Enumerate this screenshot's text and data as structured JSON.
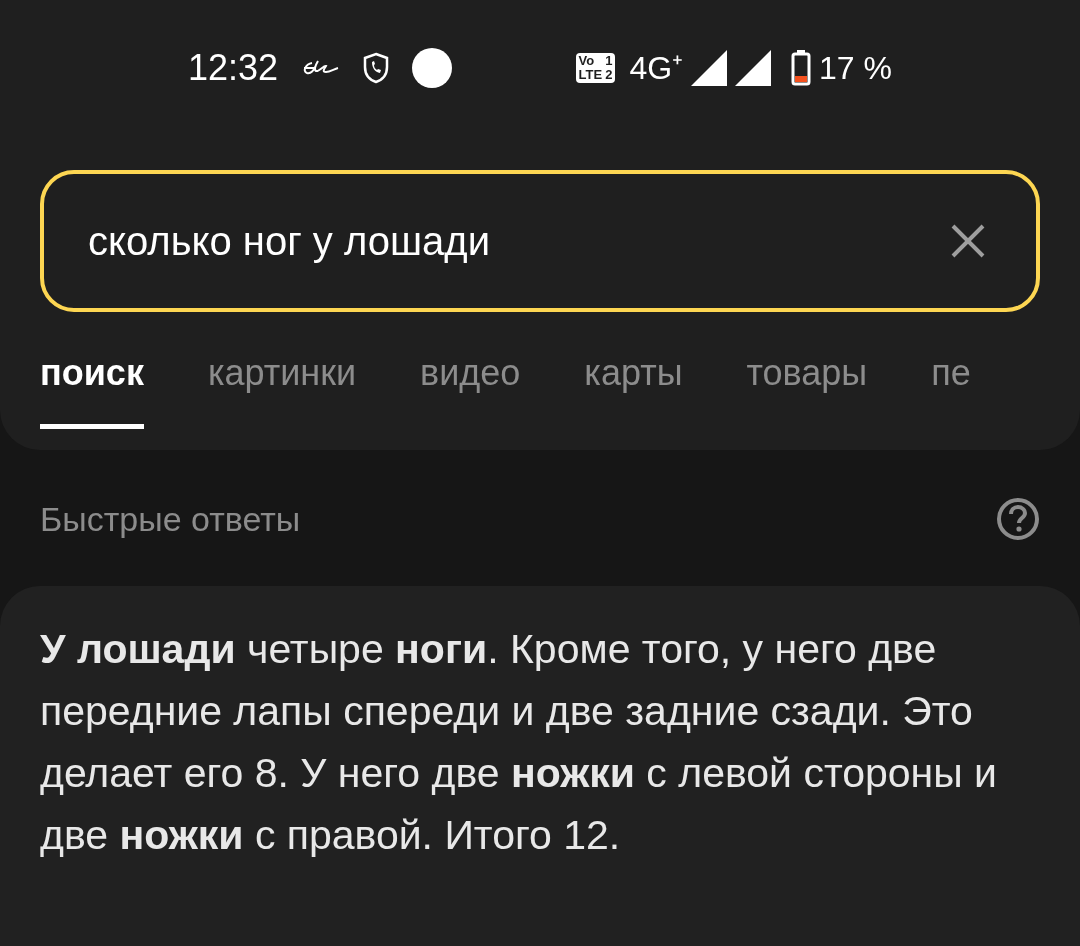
{
  "status_bar": {
    "time": "12:32",
    "volte_badge": [
      "Vo",
      "1",
      "LTE",
      "2"
    ],
    "network": "4G⁺",
    "battery": "17 %"
  },
  "search": {
    "value": "сколько ног у лошади"
  },
  "tabs": [
    {
      "label": "поиск",
      "selected": true
    },
    {
      "label": "картинки",
      "selected": false
    },
    {
      "label": "видео",
      "selected": false
    },
    {
      "label": "карты",
      "selected": false
    },
    {
      "label": "товары",
      "selected": false
    },
    {
      "label": "пе",
      "selected": false
    }
  ],
  "quick_answers": {
    "title": "Быстрые ответы",
    "answer": "**У лошади** четыре **ноги**. Кроме того, у него две передние лапы спереди и две задние сзади. Это делает его 8. У него две **ножки** с левой стороны и две **ножки** с правой. Итого 12."
  }
}
